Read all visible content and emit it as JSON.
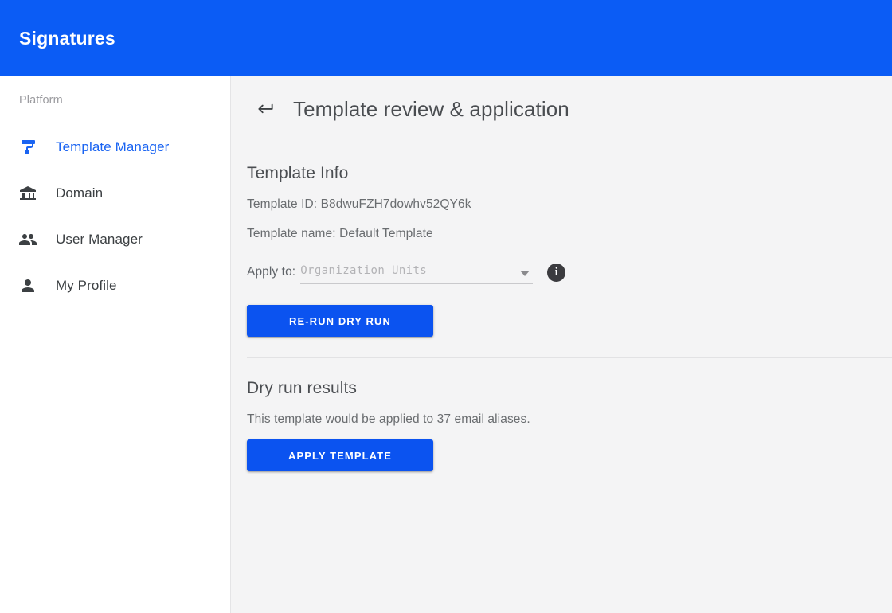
{
  "app": {
    "title": "Signatures",
    "brand_color": "#0b5cf5"
  },
  "sidebar": {
    "section_label": "Platform",
    "items": [
      {
        "label": "Template Manager",
        "icon": "paint-roller-icon",
        "active": true
      },
      {
        "label": "Domain",
        "icon": "bank-icon",
        "active": false
      },
      {
        "label": "User Manager",
        "icon": "people-icon",
        "active": false
      },
      {
        "label": "My Profile",
        "icon": "person-icon",
        "active": false
      }
    ],
    "active_color": "#1a64f2"
  },
  "header": {
    "back_icon": "back-return-arrow-icon",
    "title": "Template review & application"
  },
  "template_info": {
    "section_title": "Template Info",
    "template_id_line": "Template ID: B8dwuFZH7dowhv52QY6k",
    "template_name_line": "Template name: Default Template",
    "template_id": "B8dwuFZH7dowhv52QY6k",
    "template_name": "Default Template",
    "apply_to_label": "Apply to:",
    "apply_to_value": "",
    "apply_to_placeholder": "Organization Units",
    "apply_to_options": [
      "Organization Units"
    ],
    "info_icon_glyph": "i",
    "rerun_button_label": "RE-RUN DRY RUN"
  },
  "dry_run": {
    "section_title": "Dry run results",
    "summary": "This template would be applied to 37 email aliases.",
    "alias_count": 37,
    "apply_button_label": "APPLY TEMPLATE"
  }
}
